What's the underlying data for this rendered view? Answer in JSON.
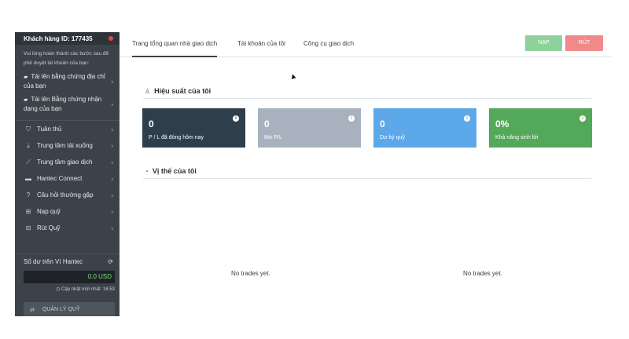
{
  "sidebar": {
    "customer_id": "Khách hàng ID: 177435",
    "note": "Vui lòng hoàn thành các bước sau để phê duyệt tài khoản của bạn:",
    "links": [
      {
        "label": "Tải lên bằng chứng địa chỉ của bạn",
        "icon": "document-icon"
      },
      {
        "label": "Tải lên Bằng chứng nhận dạng của bạn",
        "icon": "document-icon"
      }
    ],
    "menu": [
      {
        "label": "Tuân thủ",
        "icon": "shield-icon"
      },
      {
        "label": "Trung tâm tải xuống",
        "icon": "download-icon"
      },
      {
        "label": "Trung tâm giao dịch",
        "icon": "chart-line-icon"
      },
      {
        "label": "Hantec Connect",
        "icon": "briefcase-icon"
      },
      {
        "label": "Câu hỏi thường gặp",
        "icon": "question-icon"
      },
      {
        "label": "Nạp quỹ",
        "icon": "plus-square-icon"
      },
      {
        "label": "Rút Quỹ",
        "icon": "minus-square-icon"
      }
    ],
    "wallet": {
      "title": "Số dư trên Ví Hantec",
      "balance": "0.0 USD",
      "updated": "Cập nhật mới nhất: 16:53",
      "manage_label": "QUẢN LÝ QUỸ"
    }
  },
  "tabs": [
    "Trang tổng quan nhà giao dịch",
    "Tài khoản của tôi",
    "Công cụ giao dịch"
  ],
  "actions": {
    "deposit": "NẠP",
    "withdraw": "RÚT"
  },
  "performance": {
    "title": "Hiệu suất của tôi",
    "cards": [
      {
        "value": "0",
        "label": "P / L đã đóng hôm nay",
        "color": "#2f3e4b"
      },
      {
        "value": "0",
        "label": "Mở P/L",
        "color": "#a7b2be"
      },
      {
        "value": "0",
        "label": "Dư ký quỹ",
        "color": "#5ca8e8"
      },
      {
        "value": "0%",
        "label": "Khả năng sinh lời",
        "color": "#54a85a"
      }
    ]
  },
  "positions": {
    "title": "Vị thế của tôi",
    "empty_left": "No trades yet.",
    "empty_right": "No trades yet."
  },
  "colors": {
    "deposit": "#8fd19a",
    "withdraw": "#f08a8a",
    "sidebar": "#3c4249"
  }
}
